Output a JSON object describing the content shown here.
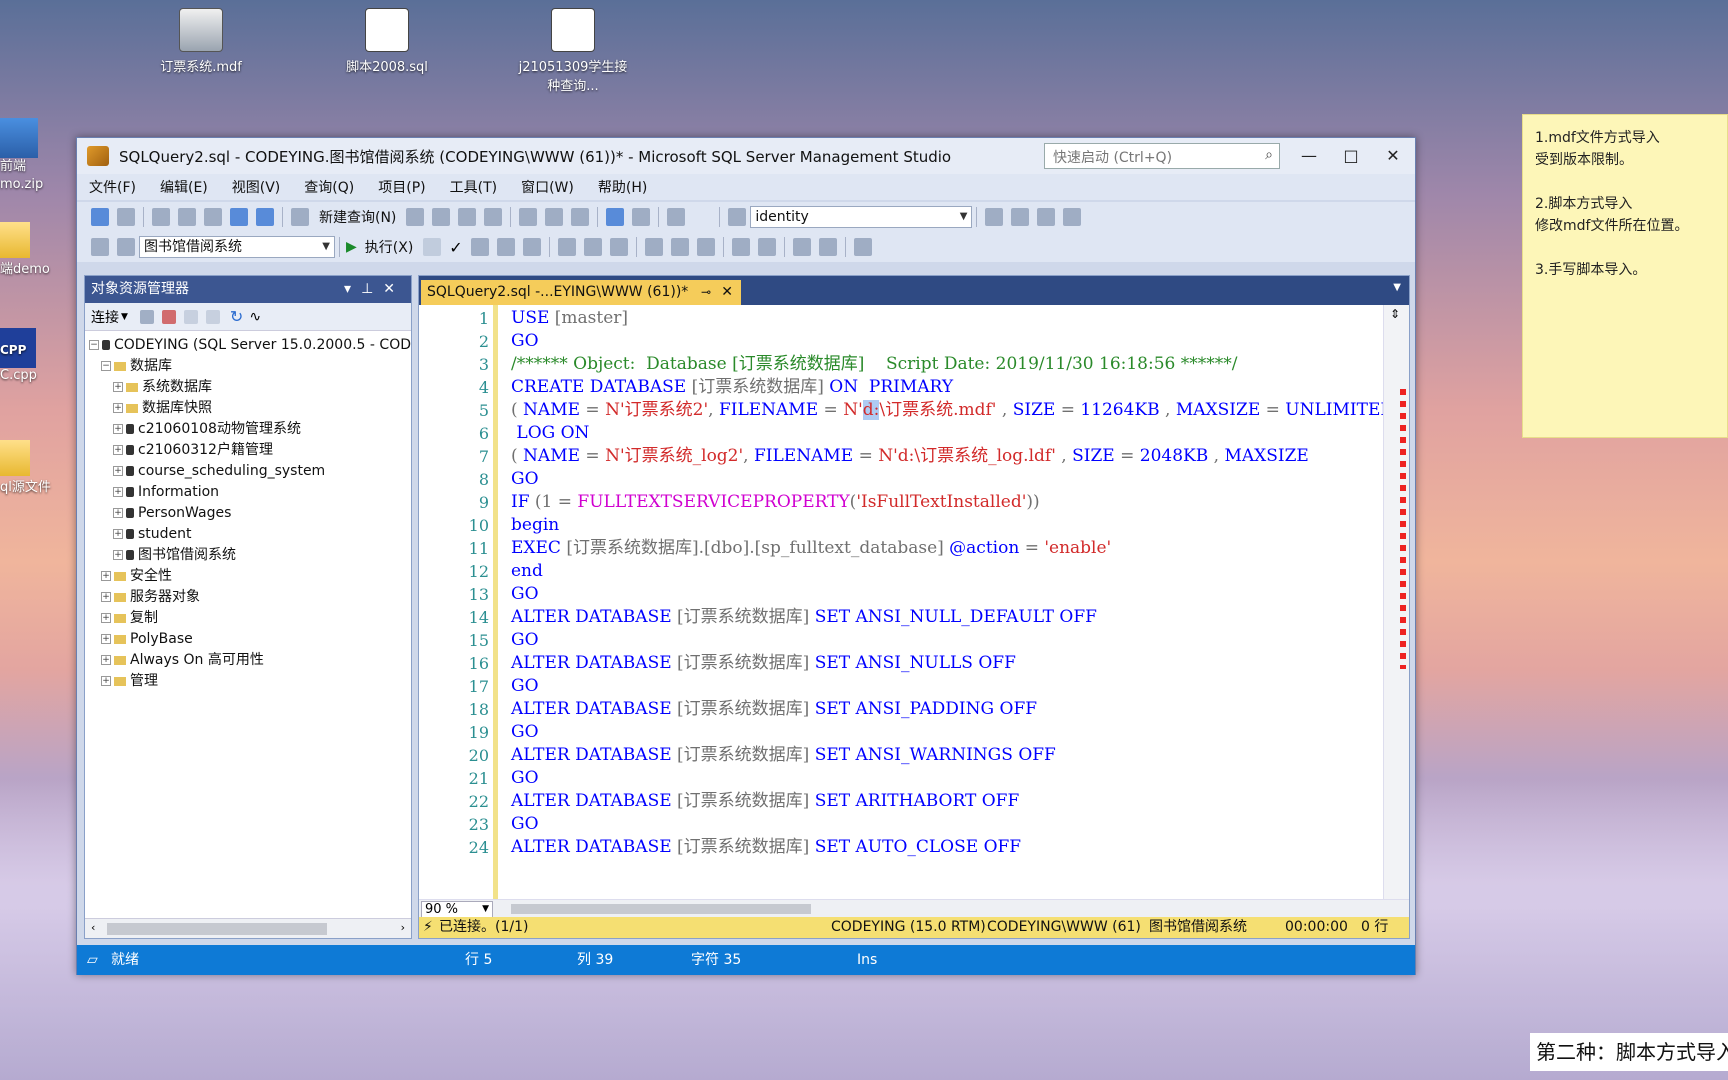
{
  "desktop": {
    "icons": [
      {
        "label": "订票系统.mdf",
        "type": "db"
      },
      {
        "label": "脚本2008.sql",
        "type": "sql"
      },
      {
        "label": "j21051309学生接种查询...",
        "type": "sql"
      }
    ],
    "left_icons": [
      {
        "label": "前端\nmo.zip"
      },
      {
        "label": "端demo"
      },
      {
        "label": "C.cpp"
      },
      {
        "label": "ql源文件"
      }
    ]
  },
  "sticky_note": {
    "lines": [
      "1.mdf文件方式导入\n受到版本限制。",
      "2.脚本方式导入\n修改mdf文件所在位置。",
      "3.手写脚本导入。"
    ]
  },
  "caption": "第二种：脚本方式导入",
  "window": {
    "title": "SQLQuery2.sql - CODEYING.图书馆借阅系统 (CODEYING\\WWW (61))* - Microsoft SQL Server Management Studio",
    "quick_launch_placeholder": "快速启动 (Ctrl+Q)",
    "menu": [
      "文件(F)",
      "编辑(E)",
      "视图(V)",
      "查询(Q)",
      "项目(P)",
      "工具(T)",
      "窗口(W)",
      "帮助(H)"
    ],
    "toolbar": {
      "new_query": "新建查询(N)",
      "identity_combo": "identity",
      "database_combo": "图书馆借阅系统",
      "execute": "执行(X)"
    }
  },
  "object_explorer": {
    "title": "对象资源管理器",
    "connect": "连接",
    "tree": [
      {
        "label": "CODEYING (SQL Server 15.0.2000.5 - COD",
        "level": 0,
        "icon": "server",
        "exp": "⊟"
      },
      {
        "label": "数据库",
        "level": 1,
        "icon": "folder",
        "exp": "⊟"
      },
      {
        "label": "系统数据库",
        "level": 2,
        "icon": "folder",
        "exp": "⊞"
      },
      {
        "label": "数据库快照",
        "level": 2,
        "icon": "folder",
        "exp": "⊞"
      },
      {
        "label": "c21060108动物管理系统",
        "level": 2,
        "icon": "db",
        "exp": "⊞"
      },
      {
        "label": "c21060312户籍管理",
        "level": 2,
        "icon": "db",
        "exp": "⊞"
      },
      {
        "label": "course_scheduling_system",
        "level": 2,
        "icon": "db",
        "exp": "⊞"
      },
      {
        "label": "Information",
        "level": 2,
        "icon": "db",
        "exp": "⊞"
      },
      {
        "label": "PersonWages",
        "level": 2,
        "icon": "db",
        "exp": "⊞"
      },
      {
        "label": "student",
        "level": 2,
        "icon": "db",
        "exp": "⊞"
      },
      {
        "label": "图书馆借阅系统",
        "level": 2,
        "icon": "db",
        "exp": "⊞"
      },
      {
        "label": "安全性",
        "level": 1,
        "icon": "folder",
        "exp": "⊞"
      },
      {
        "label": "服务器对象",
        "level": 1,
        "icon": "folder",
        "exp": "⊞"
      },
      {
        "label": "复制",
        "level": 1,
        "icon": "folder",
        "exp": "⊞"
      },
      {
        "label": "PolyBase",
        "level": 1,
        "icon": "folder",
        "exp": "⊞"
      },
      {
        "label": "Always On 高可用性",
        "level": 1,
        "icon": "folder",
        "exp": "⊞"
      },
      {
        "label": "管理",
        "level": 1,
        "icon": "folder",
        "exp": "⊞"
      }
    ]
  },
  "editor": {
    "tab_label": "SQLQuery2.sql -...EYING\\WWW (61))*",
    "zoom": "90 %",
    "lines": [
      [
        [
          "k",
          "USE "
        ],
        [
          "g",
          "[master]"
        ]
      ],
      [
        [
          "k",
          "GO"
        ]
      ],
      [
        [
          "c",
          "/****** Object:  Database [订票系统数据库]    Script Date: 2019/11/30 16:18:56 ******/"
        ]
      ],
      [
        [
          "k",
          "CREATE DATABASE "
        ],
        [
          "g",
          "[订票系统数据库] "
        ],
        [
          "k",
          "ON  PRIMARY"
        ]
      ],
      [
        [
          "g",
          "( "
        ],
        [
          "k",
          "NAME "
        ],
        [
          "g",
          "= "
        ],
        [
          "s",
          "N'订票系统2'"
        ],
        [
          "g",
          ", "
        ],
        [
          "k",
          "FILENAME "
        ],
        [
          "g",
          "= "
        ],
        [
          "s",
          "N'"
        ],
        [
          "hl",
          "d:"
        ],
        [
          "s",
          "\\订票系统.mdf'"
        ],
        [
          "g",
          " , "
        ],
        [
          "k",
          "SIZE "
        ],
        [
          "g",
          "= "
        ],
        [
          "k",
          "11264KB "
        ],
        [
          "g",
          ", "
        ],
        [
          "k",
          "MAXSIZE "
        ],
        [
          "g",
          "= "
        ],
        [
          "k",
          "UNLIMITED"
        ]
      ],
      [
        [
          "k",
          " LOG ON"
        ]
      ],
      [
        [
          "g",
          "( "
        ],
        [
          "k",
          "NAME "
        ],
        [
          "g",
          "= "
        ],
        [
          "s",
          "N'订票系统_log2'"
        ],
        [
          "g",
          ", "
        ],
        [
          "k",
          "FILENAME "
        ],
        [
          "g",
          "= "
        ],
        [
          "s",
          "N'd:\\订票系统_log.ldf'"
        ],
        [
          "g",
          " , "
        ],
        [
          "k",
          "SIZE "
        ],
        [
          "g",
          "= "
        ],
        [
          "k",
          "2048KB "
        ],
        [
          "g",
          ", "
        ],
        [
          "k",
          "MAXSIZE"
        ]
      ],
      [
        [
          "k",
          "GO"
        ]
      ],
      [
        [
          "k",
          "IF "
        ],
        [
          "g",
          "(1 = "
        ],
        [
          "f",
          "FULLTEXTSERVICEPROPERTY"
        ],
        [
          "g",
          "("
        ],
        [
          "s",
          "'IsFullTextInstalled'"
        ],
        [
          "g",
          "))"
        ]
      ],
      [
        [
          "k",
          "begin"
        ]
      ],
      [
        [
          "k",
          "EXEC "
        ],
        [
          "g",
          "[订票系统数据库].[dbo].[sp_fulltext_database] "
        ],
        [
          "k",
          "@action "
        ],
        [
          "g",
          "= "
        ],
        [
          "s",
          "'enable'"
        ]
      ],
      [
        [
          "k",
          "end"
        ]
      ],
      [
        [
          "k",
          "GO"
        ]
      ],
      [
        [
          "k",
          "ALTER DATABASE "
        ],
        [
          "g",
          "[订票系统数据库] "
        ],
        [
          "k",
          "SET ANSI_NULL_DEFAULT OFF"
        ]
      ],
      [
        [
          "k",
          "GO"
        ]
      ],
      [
        [
          "k",
          "ALTER DATABASE "
        ],
        [
          "g",
          "[订票系统数据库] "
        ],
        [
          "k",
          "SET ANSI_NULLS OFF"
        ]
      ],
      [
        [
          "k",
          "GO"
        ]
      ],
      [
        [
          "k",
          "ALTER DATABASE "
        ],
        [
          "g",
          "[订票系统数据库] "
        ],
        [
          "k",
          "SET ANSI_PADDING OFF"
        ]
      ],
      [
        [
          "k",
          "GO"
        ]
      ],
      [
        [
          "k",
          "ALTER DATABASE "
        ],
        [
          "g",
          "[订票系统数据库] "
        ],
        [
          "k",
          "SET ANSI_WARNINGS OFF"
        ]
      ],
      [
        [
          "k",
          "GO"
        ]
      ],
      [
        [
          "k",
          "ALTER DATABASE "
        ],
        [
          "g",
          "[订票系统数据库] "
        ],
        [
          "k",
          "SET ARITHABORT OFF"
        ]
      ],
      [
        [
          "k",
          "GO"
        ]
      ],
      [
        [
          "k",
          "ALTER DATABASE "
        ],
        [
          "g",
          "[订票系统数据库] "
        ],
        [
          "k",
          "SET AUTO_CLOSE OFF"
        ]
      ]
    ],
    "query_status": {
      "connected": "已连接。(1/1)",
      "server": "CODEYING (15.0 RTM)",
      "user": "CODEYING\\WWW (61)",
      "database": "图书馆借阅系统",
      "time": "00:00:00",
      "rows": "0 行"
    }
  },
  "statusbar": {
    "ready": "就绪",
    "row": "行 5",
    "col": "列 39",
    "char": "字符 35",
    "mode": "Ins"
  }
}
